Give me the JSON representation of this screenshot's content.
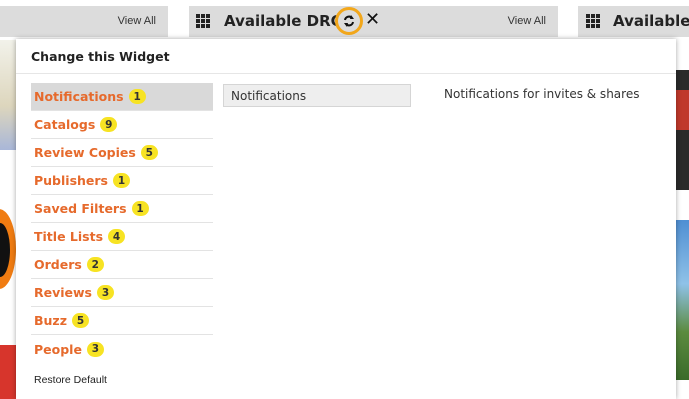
{
  "header_left": {
    "view_all": "View All"
  },
  "header_mid": {
    "title": "Available DRCs",
    "view_all": "View All"
  },
  "header_right": {
    "title": "Available E"
  },
  "popup": {
    "title": "Change this Widget",
    "menu": [
      {
        "label": "Notifications",
        "count": "1"
      },
      {
        "label": "Catalogs",
        "count": "9"
      },
      {
        "label": "Review Copies",
        "count": "5"
      },
      {
        "label": "Publishers",
        "count": "1"
      },
      {
        "label": "Saved Filters",
        "count": "1"
      },
      {
        "label": "Title Lists",
        "count": "4"
      },
      {
        "label": "Orders",
        "count": "2"
      },
      {
        "label": "Reviews",
        "count": "3"
      },
      {
        "label": "Buzz",
        "count": "5"
      },
      {
        "label": "People",
        "count": "3"
      }
    ],
    "restore": "Restore Default",
    "submenu_item": "Notifications",
    "description": "Notifications for invites & shares"
  },
  "colors": {
    "menu_text": "#e66a2c",
    "badge": "#f7e323",
    "highlight_ring": "#f2a71b",
    "header_bg": "#dcdcdc"
  },
  "icons": [
    "grid-icon",
    "refresh-icon",
    "close-icon",
    "arrow-right-icon"
  ]
}
